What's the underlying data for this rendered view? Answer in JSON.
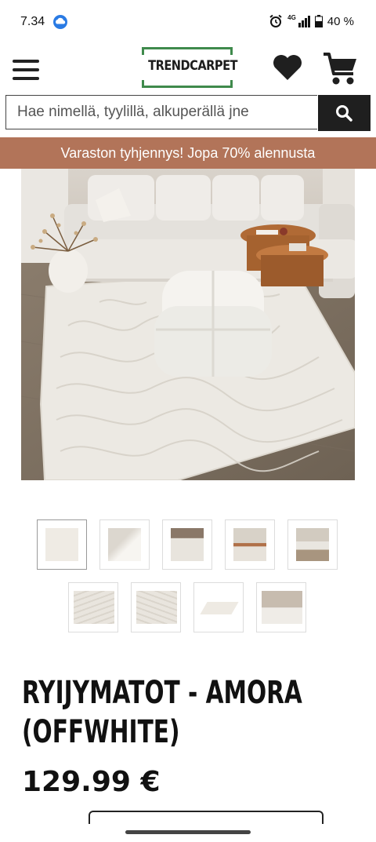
{
  "status_bar": {
    "time": "7.34",
    "network": "4G",
    "battery": "40 %"
  },
  "header": {
    "logo_text": "TRENDCARPET",
    "brand_color": "#3f8a4c"
  },
  "search": {
    "placeholder": "Hae nimellä, tyylillä, alkuperällä jne"
  },
  "promo": {
    "text": "Varaston tyhjennys! Jopa 70% alennusta",
    "bg_color": "#b27459"
  },
  "gallery": {
    "thumbnails": [
      {
        "name": "rug-flat",
        "selected": true
      },
      {
        "name": "pouf-closeup",
        "selected": false
      },
      {
        "name": "room-side",
        "selected": false
      },
      {
        "name": "living-room",
        "selected": false
      },
      {
        "name": "living-room-wide",
        "selected": false
      },
      {
        "name": "pattern-detail-1",
        "selected": false
      },
      {
        "name": "pattern-detail-2",
        "selected": false
      },
      {
        "name": "rug-angle",
        "selected": false
      },
      {
        "name": "room-sofa",
        "selected": false
      }
    ]
  },
  "product": {
    "title_line1": "RYIJYMATOT - AMORA",
    "title_line2": "(OFFWHITE)",
    "price": "129.99 €"
  }
}
